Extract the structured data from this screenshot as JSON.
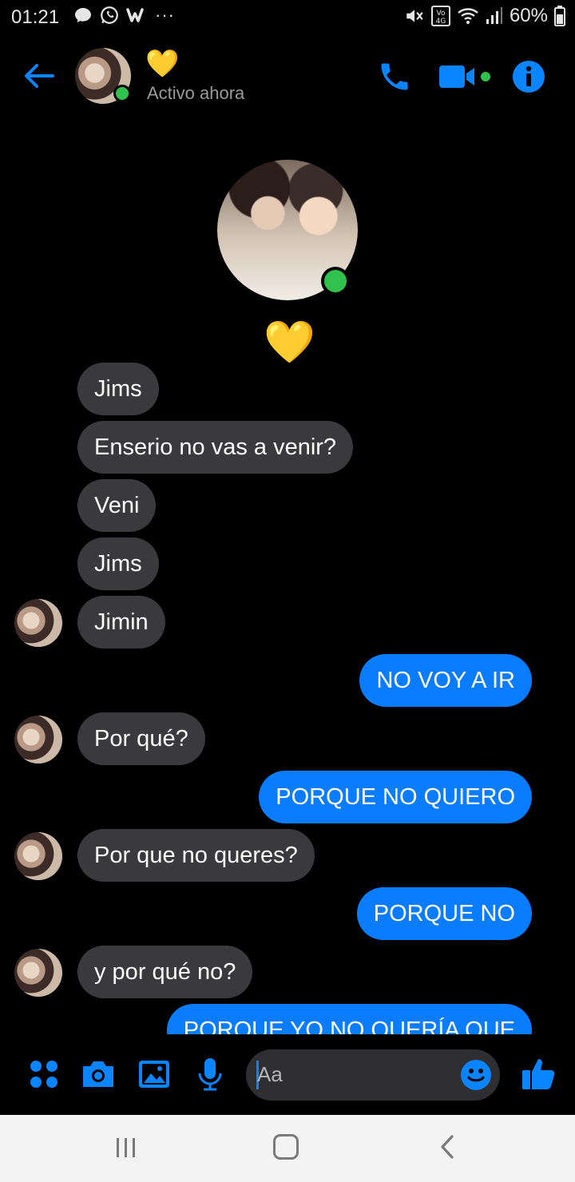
{
  "status_bar": {
    "time": "01:21",
    "overflow": "···",
    "battery": "60%",
    "left_icons": [
      "chat-bubble-icon",
      "whatsapp-icon",
      "wattpad-icon"
    ],
    "right_icons": [
      "mute-icon",
      "volte-4g-icon",
      "wifi-icon",
      "signal-icon",
      "battery-icon"
    ]
  },
  "header": {
    "name": "💛",
    "status": "Activo ahora",
    "accent_color": "#0a84ff",
    "online_color": "#31c24d"
  },
  "profile": {
    "name": "💛"
  },
  "messages": [
    {
      "side": "in",
      "text": "Jims"
    },
    {
      "side": "in",
      "text": "Enserio no vas a venir?"
    },
    {
      "side": "in",
      "text": "Veni"
    },
    {
      "side": "in",
      "text": "Jims"
    },
    {
      "side": "in",
      "text": "Jimin"
    },
    {
      "side": "out",
      "text": "NO VOY A IR"
    },
    {
      "side": "in",
      "text": "Por qué?"
    },
    {
      "side": "out",
      "text": "PORQUE NO QUIERO"
    },
    {
      "side": "in",
      "text": "Por que no queres?"
    },
    {
      "side": "out",
      "text": "PORQUE NO"
    },
    {
      "side": "in",
      "text": "y por qué no?"
    },
    {
      "side": "out",
      "text": "PORQUE YO NO QUERÍA QUE"
    }
  ],
  "composer": {
    "placeholder": "Aa",
    "icons": [
      "apps-icon",
      "camera-icon",
      "gallery-icon",
      "microphone-icon",
      "emoji-icon",
      "thumbs-up-icon"
    ]
  },
  "colors": {
    "incoming_bubble": "#3a3a3c",
    "outgoing_bubble": "#0a7cff",
    "background": "#000000"
  }
}
